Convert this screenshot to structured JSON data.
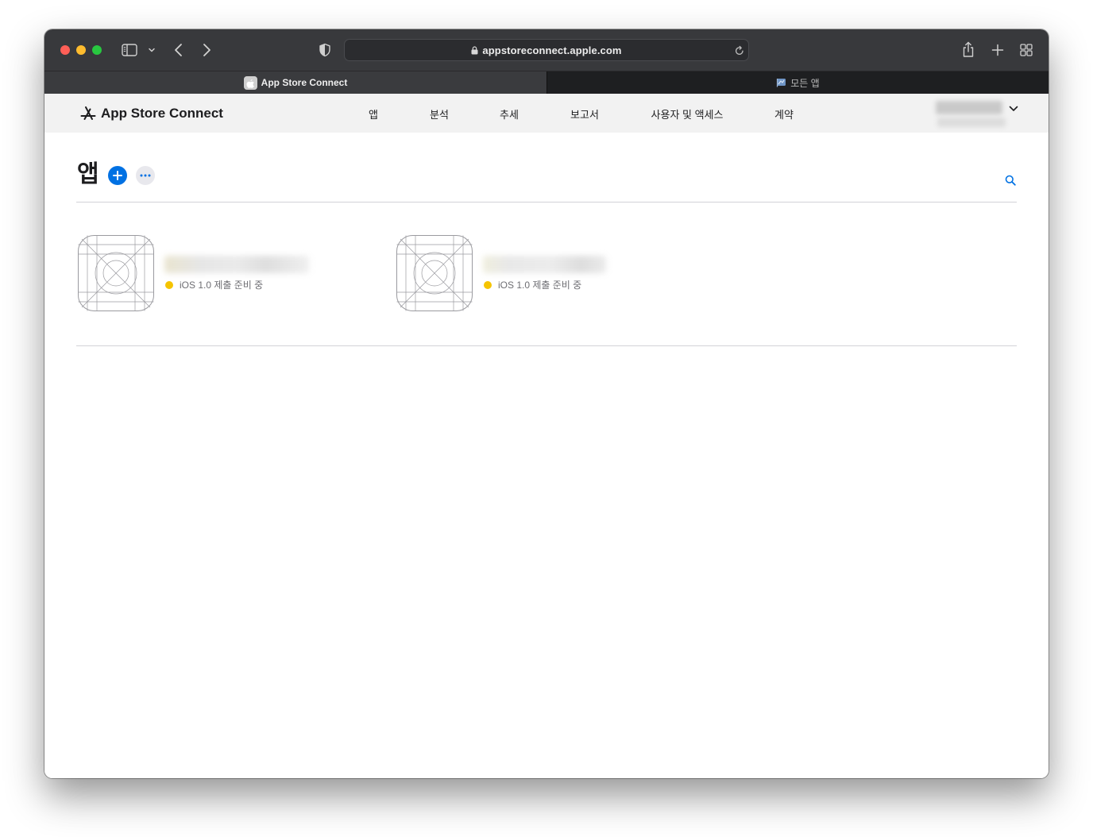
{
  "browser": {
    "url": "appstoreconnect.apple.com",
    "tabs": [
      {
        "label": "App Store Connect",
        "active": true
      },
      {
        "label": "모든 앱",
        "active": false
      }
    ]
  },
  "header": {
    "brand": "App Store Connect",
    "nav": [
      {
        "label": "앱"
      },
      {
        "label": "분석"
      },
      {
        "label": "추세"
      },
      {
        "label": "보고서"
      },
      {
        "label": "사용자 및 액세스"
      },
      {
        "label": "계약"
      }
    ]
  },
  "page": {
    "title": "앱"
  },
  "apps": [
    {
      "status": "iOS 1.0 제출 준비 중"
    },
    {
      "status": "iOS 1.0 제출 준비 중"
    }
  ],
  "icons": {
    "toolbar": [
      "sidebar-icon",
      "chevron-down-icon",
      "back-icon",
      "forward-icon",
      "shield-icon",
      "lock-icon",
      "reload-icon",
      "share-icon",
      "new-tab-icon",
      "tab-overview-icon"
    ],
    "tabs": [
      "apple-favicon-icon",
      "flag-favicon-icon"
    ],
    "content": [
      "app-store-icon",
      "plus-icon",
      "more-icon",
      "search-icon",
      "app-icon-placeholder",
      "status-dot-icon"
    ]
  },
  "colors": {
    "accent": "#0071e3",
    "status": "#f5c400",
    "toolbar": "#38393c",
    "nav_background": "#f2f2f2"
  }
}
